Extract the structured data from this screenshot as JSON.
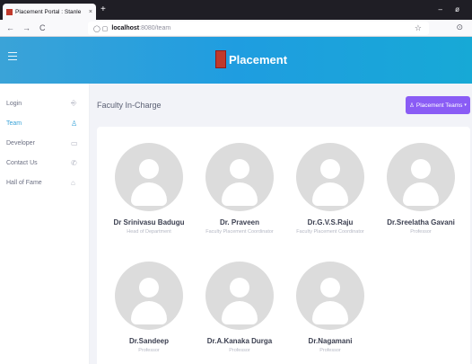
{
  "browser": {
    "tab_title": "Placement Portal : Stanle",
    "tab_close": "×",
    "new_tab": "+",
    "window_controls": "– ø",
    "back": "←",
    "forward": "→",
    "reload": "C",
    "url_icons": "◯ ▢",
    "url_host": "localhost",
    "url_rest": ":8080/team",
    "bookmark": "☆",
    "shield": "⊙"
  },
  "app": {
    "brand": "Placement"
  },
  "sidebar": {
    "items": [
      {
        "label": "Login",
        "icon": "⎆",
        "active": false
      },
      {
        "label": "Team",
        "icon": "♙",
        "active": true
      },
      {
        "label": "Developer",
        "icon": "▭",
        "active": false
      },
      {
        "label": "Contact Us",
        "icon": "✆",
        "active": false
      },
      {
        "label": "Hall of Fame",
        "icon": "⌂",
        "active": false
      }
    ]
  },
  "main": {
    "title": "Faculty In-Charge",
    "teams_button": {
      "icon": "♙",
      "label": "Placement Teams",
      "caret": "▾"
    },
    "members": [
      {
        "name": "Dr Srinivasu Badugu",
        "role": "Head of Department"
      },
      {
        "name": "Dr. Praveen",
        "role": "Faculty Placement Coordinator"
      },
      {
        "name": "Dr.G.V.S.Raju",
        "role": "Faculty Placement Coordinator"
      },
      {
        "name": "Dr.Sreelatha Gavani",
        "role": "Professor"
      },
      {
        "name": "Dr.Sandeep",
        "role": "Professor"
      },
      {
        "name": "Dr.A.Kanaka Durga",
        "role": "Professor"
      },
      {
        "name": "Dr.Nagamani",
        "role": "Professor"
      }
    ]
  },
  "colors": {
    "header_gradient_start": "#3aa3d8",
    "header_gradient_end": "#17a9d6",
    "accent": "#3aa3d8",
    "button_purple": "#8a5cf5",
    "brand_red": "#c0392b"
  }
}
